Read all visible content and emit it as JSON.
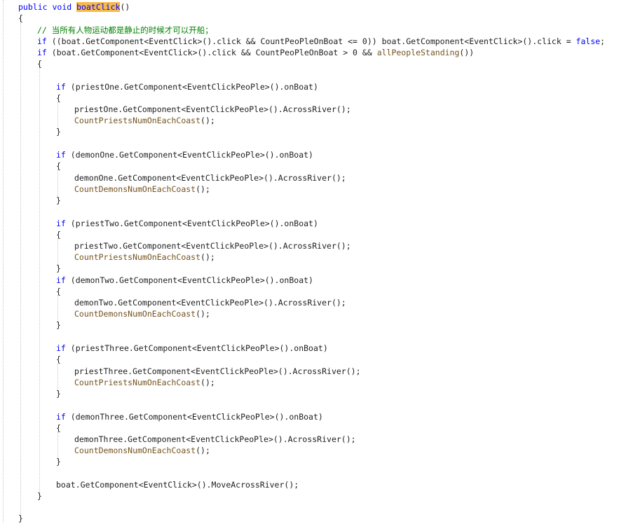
{
  "code": {
    "l1": {
      "kw1": "public",
      "kw2": "void",
      "name": "boatClick",
      "tail": "()"
    },
    "l2": "{",
    "l3": "// 当所有人物运动都是静止的时候才可以开船；",
    "l4": {
      "kw": "if",
      "text": "((boat.GetComponent<EventClick>().click && CountPeoPleOnBoat <= 0)) boat.GetComponent<EventClick>().click = ",
      "kw_false": "false",
      "semi": ";"
    },
    "l5": {
      "kw": "if",
      "text": "(boat.GetComponent<EventClick>().click && CountPeoPleOnBoat > 0 && ",
      "fn": "allPeopleStanding",
      "tail": "())"
    },
    "l6": "{",
    "blocks": [
      {
        "if_kw": "if",
        "cond": "(priestOne.GetComponent<EventClickPeoPle>().onBoat)",
        "open": "{",
        "call": "priestOne.GetComponent<EventClickPeoPle>().AcrossRiver();",
        "count_fn": "CountPriestsNumOnEachCoast",
        "count_tail": "();",
        "close": "}"
      },
      {
        "if_kw": "if",
        "cond": "(demonOne.GetComponent<EventClickPeoPle>().onBoat)",
        "open": "{",
        "call": "demonOne.GetComponent<EventClickPeoPle>().AcrossRiver();",
        "count_fn": "CountDemonsNumOnEachCoast",
        "count_tail": "();",
        "close": "}"
      },
      {
        "if_kw": "if",
        "cond": "(priestTwo.GetComponent<EventClickPeoPle>().onBoat)",
        "open": "{",
        "call": "priestTwo.GetComponent<EventClickPeoPle>().AcrossRiver();",
        "count_fn": "CountPriestsNumOnEachCoast",
        "count_tail": "();",
        "close": "}"
      },
      {
        "if_kw": "if",
        "cond": "(demonTwo.GetComponent<EventClickPeoPle>().onBoat)",
        "open": "{",
        "call": "demonTwo.GetComponent<EventClickPeoPle>().AcrossRiver();",
        "count_fn": "CountDemonsNumOnEachCoast",
        "count_tail": "();",
        "close": "}"
      },
      {
        "if_kw": "if",
        "cond": "(priestThree.GetComponent<EventClickPeoPle>().onBoat)",
        "open": "{",
        "call": "priestThree.GetComponent<EventClickPeoPle>().AcrossRiver();",
        "count_fn": "CountPriestsNumOnEachCoast",
        "count_tail": "();",
        "close": "}"
      },
      {
        "if_kw": "if",
        "cond": "(demonThree.GetComponent<EventClickPeoPle>().onBoat)",
        "open": "{",
        "call": "demonThree.GetComponent<EventClickPeoPle>().AcrossRiver();",
        "count_fn": "CountDemonsNumOnEachCoast",
        "count_tail": "();",
        "close": "}"
      }
    ],
    "move": "boat.GetComponent<EventClick>().MoveAcrossRiver();",
    "close_inner": "}",
    "close_outer": "}"
  },
  "colors": {
    "keyword": "#0000ff",
    "comment": "#008000",
    "method": "#74531f",
    "highlight": "#f6b94c"
  }
}
